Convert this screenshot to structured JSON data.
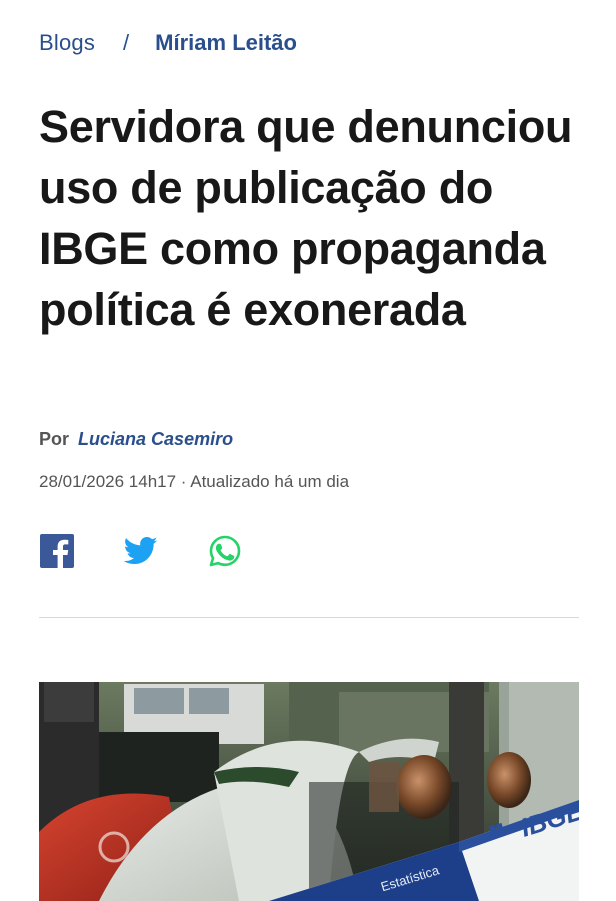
{
  "breadcrumb": {
    "home": "Blogs",
    "separator": "/",
    "current": "Míriam Leitão"
  },
  "article": {
    "headline": "Servidora que denunciou uso de publicação do IBGE como propaganda política é exonerada",
    "byline_prefix": "Por",
    "author": "Luciana Casemiro",
    "dateline": "28/01/2026 14h17 · Atualizado há um dia"
  },
  "share": {
    "icons": [
      "facebook-icon",
      "twitter-icon",
      "whatsapp-icon"
    ],
    "colors": {
      "facebook": "#3b5998",
      "twitter": "#1da1f2",
      "whatsapp": "#25d366"
    }
  },
  "photo": {
    "sign_brand": "IBGE",
    "sign_subtext": "Estatística"
  },
  "colors": {
    "accent": "#2a4f8c",
    "headline": "#181818",
    "meta": "#555555"
  }
}
